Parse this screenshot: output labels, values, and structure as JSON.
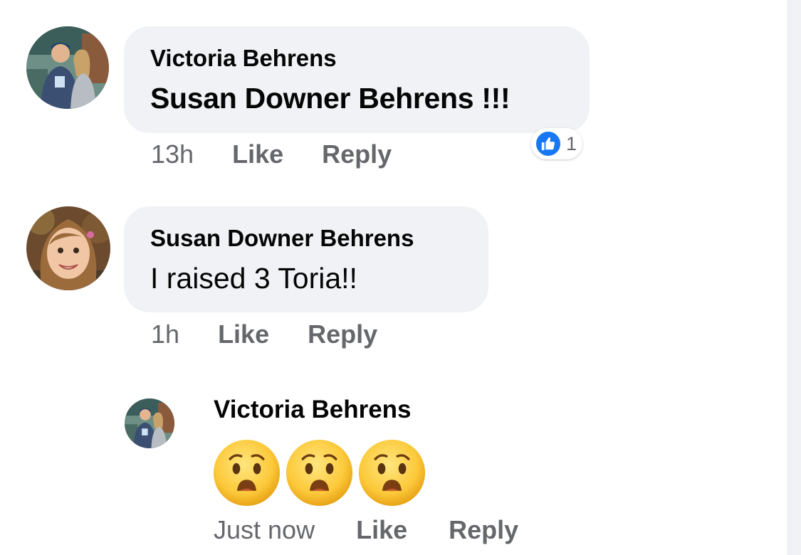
{
  "comments": [
    {
      "author": "Victoria Behrens",
      "text": "Susan Downer Behrens !!!",
      "time": "13h",
      "like_label": "Like",
      "reply_label": "Reply",
      "reaction": {
        "icon": "thumbs-up-icon",
        "count": "1",
        "color": "#1877f2"
      }
    },
    {
      "author": "Susan Downer Behrens",
      "text": "I raised 3 Toria!!",
      "time": "1h",
      "like_label": "Like",
      "reply_label": "Reply"
    }
  ],
  "reply": {
    "author": "Victoria Behrens",
    "emojis": [
      "hushed-face-icon",
      "hushed-face-icon",
      "hushed-face-icon"
    ],
    "time": "Just now",
    "like_label": "Like",
    "reply_label": "Reply"
  },
  "colors": {
    "bubble": "#f0f2f5",
    "secondary_text": "#65676b",
    "primary_text": "#050505",
    "like_blue": "#1877f2"
  }
}
